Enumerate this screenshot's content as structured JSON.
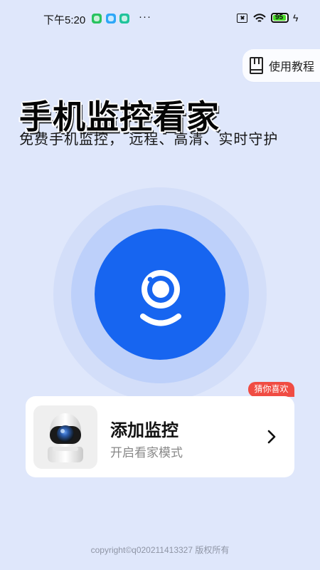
{
  "status_bar": {
    "time": "下午5:20",
    "more": "···",
    "battery": "95",
    "icons": [
      "green-message-icon",
      "blue-app-icon",
      "teal-app-icon",
      "sim-icon",
      "wifi-icon",
      "battery-icon",
      "charging-bolt-icon"
    ]
  },
  "header": {
    "tutorial_label": "使用教程",
    "title": "手机监控看家",
    "subtitle": "免费手机监控， 远程、高清、实时守护"
  },
  "main": {
    "camera_button_icon": "camera-icon"
  },
  "card": {
    "badge": "猜你喜欢",
    "title": "添加监控",
    "description": "开启看家模式",
    "thumbnail_icon": "security-camera-icon",
    "action_icon": "chevron-right-icon"
  },
  "footer": {
    "copyright": "copyright©q020211413327 版权所有"
  },
  "colors": {
    "background": "#dfe7fb",
    "primary_blue": "#1765f0",
    "light_ring": "#d3def9",
    "middle_ring": "#bdd0fa",
    "card": "#ffffff",
    "badge": "#f04c43"
  }
}
